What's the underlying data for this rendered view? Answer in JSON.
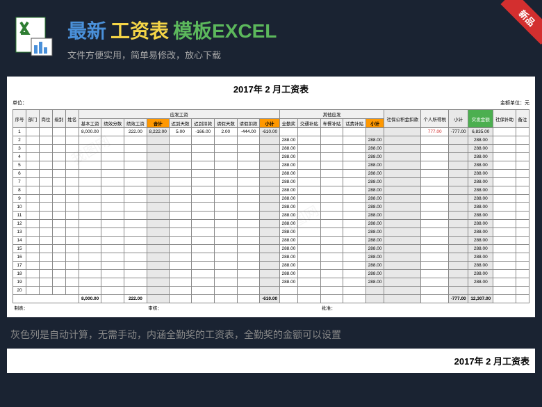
{
  "badge": "新品",
  "title": {
    "p1": "最新",
    "p2": "工资表",
    "p3": "模板EXCEL"
  },
  "subtitle": "文件方便实用，简单易修改，放心下载",
  "sheet": {
    "title": "2017年  2 月工资表",
    "unit_label": "单位：",
    "currency_label": "金额单位：元",
    "group_yingfa": "应发工资",
    "group_qita": "其他应发",
    "headers": [
      "序号",
      "部门",
      "岗位",
      "级别",
      "姓名",
      "基本工资",
      "绩效分数",
      "绩效工资",
      "合计",
      "迟到天数",
      "迟到扣款",
      "请假天数",
      "请假扣款",
      "小计",
      "全勤奖",
      "交通补贴",
      "车餐补贴",
      "话费补贴",
      "小计",
      "社保公积金扣款",
      "个人所得税",
      "小计",
      "实发金额",
      "社保补助",
      "备注"
    ],
    "rows": [
      {
        "n": "1",
        "base": "8,000.00",
        "perf": "222.00",
        "heji": "8,222.00",
        "ld": "5.00",
        "ldk": "-166.00",
        "qj": "2.00",
        "qjk": "-444.00",
        "xj1": "-610.00",
        "qt": "",
        "sb": "",
        "tax": "777.00",
        "xj3": "-777.00",
        "sf": "6,835.00"
      },
      {
        "n": "2",
        "qt": "288.00",
        "xj2": "288.00",
        "sf": "288.00"
      },
      {
        "n": "3",
        "qt": "288.00",
        "xj2": "288.00",
        "sf": "288.00"
      },
      {
        "n": "4",
        "qt": "288.00",
        "xj2": "288.00",
        "sf": "288.00"
      },
      {
        "n": "5",
        "qt": "288.00",
        "xj2": "288.00",
        "sf": "288.00"
      },
      {
        "n": "6",
        "qt": "288.00",
        "xj2": "288.00",
        "sf": "288.00"
      },
      {
        "n": "7",
        "qt": "288.00",
        "xj2": "288.00",
        "sf": "288.00"
      },
      {
        "n": "8",
        "qt": "288.00",
        "xj2": "288.00",
        "sf": "288.00"
      },
      {
        "n": "9",
        "qt": "288.00",
        "xj2": "288.00",
        "sf": "288.00"
      },
      {
        "n": "10",
        "qt": "288.00",
        "xj2": "288.00",
        "sf": "288.00"
      },
      {
        "n": "11",
        "qt": "288.00",
        "xj2": "288.00",
        "sf": "288.00"
      },
      {
        "n": "12",
        "qt": "288.00",
        "xj2": "288.00",
        "sf": "288.00"
      },
      {
        "n": "13",
        "qt": "288.00",
        "xj2": "288.00",
        "sf": "288.00"
      },
      {
        "n": "14",
        "qt": "288.00",
        "xj2": "288.00",
        "sf": "288.00"
      },
      {
        "n": "15",
        "qt": "288.00",
        "xj2": "288.00",
        "sf": "288.00"
      },
      {
        "n": "16",
        "qt": "288.00",
        "xj2": "288.00",
        "sf": "288.00"
      },
      {
        "n": "17",
        "qt": "288.00",
        "xj2": "288.00",
        "sf": "288.00"
      },
      {
        "n": "18",
        "qt": "288.00",
        "xj2": "288.00",
        "sf": "288.00"
      },
      {
        "n": "19",
        "qt": "288.00",
        "xj2": "288.00",
        "sf": "288.00"
      },
      {
        "n": "20"
      }
    ],
    "totals": {
      "base": "8,000.00",
      "perf": "222.00",
      "xj1": "-610.00",
      "xj3": "-777.00",
      "sf": "12,307.00"
    },
    "footer": {
      "l1": "制表：",
      "l2": "审核：",
      "l3": "批准："
    }
  },
  "description": "灰色列是自动计算，无需手动，内涵全勤奖的工资表，全勤奖的金额可以设置",
  "bottom_title": "2017年  2 月工资表"
}
